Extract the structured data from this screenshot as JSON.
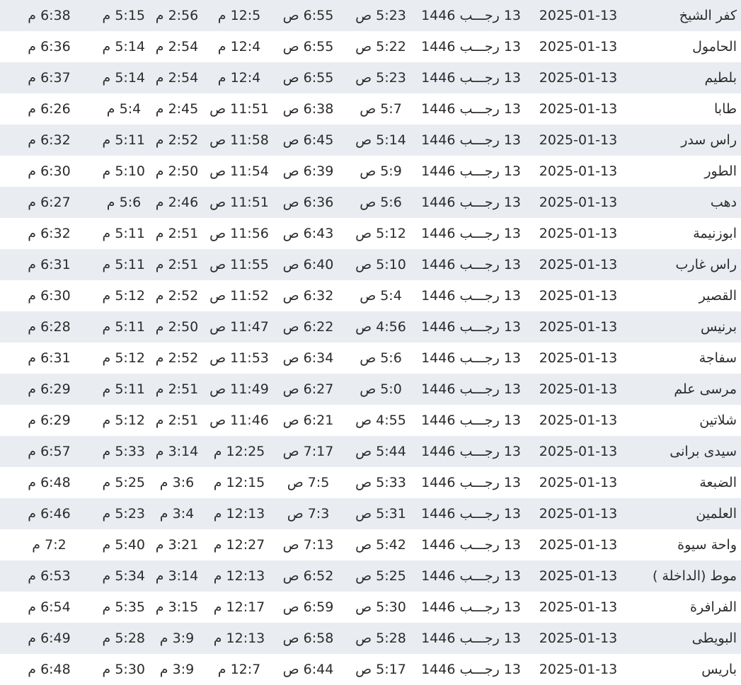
{
  "rows": [
    {
      "city": "كفر الشيخ",
      "gregorian": "2025-01-13",
      "hijri": "13 رجـــب 1446",
      "fajr": "5:23 ص",
      "sunrise": "6:55 ص",
      "dhuhr": "12:5 م",
      "asr": "2:56 م",
      "maghrib": "5:15 م",
      "isha": "6:38 م"
    },
    {
      "city": "الحامول",
      "gregorian": "2025-01-13",
      "hijri": "13 رجـــب 1446",
      "fajr": "5:22 ص",
      "sunrise": "6:55 ص",
      "dhuhr": "12:4 م",
      "asr": "2:54 م",
      "maghrib": "5:14 م",
      "isha": "6:36 م"
    },
    {
      "city": "بلطيم",
      "gregorian": "2025-01-13",
      "hijri": "13 رجـــب 1446",
      "fajr": "5:23 ص",
      "sunrise": "6:55 ص",
      "dhuhr": "12:4 م",
      "asr": "2:54 م",
      "maghrib": "5:14 م",
      "isha": "6:37 م"
    },
    {
      "city": "طابا",
      "gregorian": "2025-01-13",
      "hijri": "13 رجـــب 1446",
      "fajr": "5:7 ص",
      "sunrise": "6:38 ص",
      "dhuhr": "11:51 ص",
      "asr": "2:45 م",
      "maghrib": "5:4 م",
      "isha": "6:26 م"
    },
    {
      "city": "راس سدر",
      "gregorian": "2025-01-13",
      "hijri": "13 رجـــب 1446",
      "fajr": "5:14 ص",
      "sunrise": "6:45 ص",
      "dhuhr": "11:58 ص",
      "asr": "2:52 م",
      "maghrib": "5:11 م",
      "isha": "6:32 م"
    },
    {
      "city": "الطور",
      "gregorian": "2025-01-13",
      "hijri": "13 رجـــب 1446",
      "fajr": "5:9 ص",
      "sunrise": "6:39 ص",
      "dhuhr": "11:54 ص",
      "asr": "2:50 م",
      "maghrib": "5:10 م",
      "isha": "6:30 م"
    },
    {
      "city": "دهب",
      "gregorian": "2025-01-13",
      "hijri": "13 رجـــب 1446",
      "fajr": "5:6 ص",
      "sunrise": "6:36 ص",
      "dhuhr": "11:51 ص",
      "asr": "2:46 م",
      "maghrib": "5:6 م",
      "isha": "6:27 م"
    },
    {
      "city": "ابوزنيمة",
      "gregorian": "2025-01-13",
      "hijri": "13 رجـــب 1446",
      "fajr": "5:12 ص",
      "sunrise": "6:43 ص",
      "dhuhr": "11:56 ص",
      "asr": "2:51 م",
      "maghrib": "5:11 م",
      "isha": "6:32 م"
    },
    {
      "city": "راس غارب",
      "gregorian": "2025-01-13",
      "hijri": "13 رجـــب 1446",
      "fajr": "5:10 ص",
      "sunrise": "6:40 ص",
      "dhuhr": "11:55 ص",
      "asr": "2:51 م",
      "maghrib": "5:11 م",
      "isha": "6:31 م"
    },
    {
      "city": "القصير",
      "gregorian": "2025-01-13",
      "hijri": "13 رجـــب 1446",
      "fajr": "5:4 ص",
      "sunrise": "6:32 ص",
      "dhuhr": "11:52 ص",
      "asr": "2:52 م",
      "maghrib": "5:12 م",
      "isha": "6:30 م"
    },
    {
      "city": "برنيس",
      "gregorian": "2025-01-13",
      "hijri": "13 رجـــب 1446",
      "fajr": "4:56 ص",
      "sunrise": "6:22 ص",
      "dhuhr": "11:47 ص",
      "asr": "2:50 م",
      "maghrib": "5:11 م",
      "isha": "6:28 م"
    },
    {
      "city": "سفاجة",
      "gregorian": "2025-01-13",
      "hijri": "13 رجـــب 1446",
      "fajr": "5:6 ص",
      "sunrise": "6:34 ص",
      "dhuhr": "11:53 ص",
      "asr": "2:52 م",
      "maghrib": "5:12 م",
      "isha": "6:31 م"
    },
    {
      "city": "مرسى علم",
      "gregorian": "2025-01-13",
      "hijri": "13 رجـــب 1446",
      "fajr": "5:0 ص",
      "sunrise": "6:27 ص",
      "dhuhr": "11:49 ص",
      "asr": "2:51 م",
      "maghrib": "5:11 م",
      "isha": "6:29 م"
    },
    {
      "city": "شلاتين",
      "gregorian": "2025-01-13",
      "hijri": "13 رجـــب 1446",
      "fajr": "4:55 ص",
      "sunrise": "6:21 ص",
      "dhuhr": "11:46 ص",
      "asr": "2:51 م",
      "maghrib": "5:12 م",
      "isha": "6:29 م"
    },
    {
      "city": "سيدى برانى",
      "gregorian": "2025-01-13",
      "hijri": "13 رجـــب 1446",
      "fajr": "5:44 ص",
      "sunrise": "7:17 ص",
      "dhuhr": "12:25 م",
      "asr": "3:14 م",
      "maghrib": "5:33 م",
      "isha": "6:57 م"
    },
    {
      "city": "الضبعة",
      "gregorian": "2025-01-13",
      "hijri": "13 رجـــب 1446",
      "fajr": "5:33 ص",
      "sunrise": "7:5 ص",
      "dhuhr": "12:15 م",
      "asr": "3:6 م",
      "maghrib": "5:25 م",
      "isha": "6:48 م"
    },
    {
      "city": "العلمين",
      "gregorian": "2025-01-13",
      "hijri": "13 رجـــب 1446",
      "fajr": "5:31 ص",
      "sunrise": "7:3 ص",
      "dhuhr": "12:13 م",
      "asr": "3:4 م",
      "maghrib": "5:23 م",
      "isha": "6:46 م"
    },
    {
      "city": "واحة سيوة",
      "gregorian": "2025-01-13",
      "hijri": "13 رجـــب 1446",
      "fajr": "5:42 ص",
      "sunrise": "7:13 ص",
      "dhuhr": "12:27 م",
      "asr": "3:21 م",
      "maghrib": "5:40 م",
      "isha": "7:2 م"
    },
    {
      "city": "موط (الداخلة )",
      "gregorian": "2025-01-13",
      "hijri": "13 رجـــب 1446",
      "fajr": "5:25 ص",
      "sunrise": "6:52 ص",
      "dhuhr": "12:13 م",
      "asr": "3:14 م",
      "maghrib": "5:34 م",
      "isha": "6:53 م"
    },
    {
      "city": "الفرافرة",
      "gregorian": "2025-01-13",
      "hijri": "13 رجـــب 1446",
      "fajr": "5:30 ص",
      "sunrise": "6:59 ص",
      "dhuhr": "12:17 م",
      "asr": "3:15 م",
      "maghrib": "5:35 م",
      "isha": "6:54 م"
    },
    {
      "city": "البويطى",
      "gregorian": "2025-01-13",
      "hijri": "13 رجـــب 1446",
      "fajr": "5:28 ص",
      "sunrise": "6:58 ص",
      "dhuhr": "12:13 م",
      "asr": "3:9 م",
      "maghrib": "5:28 م",
      "isha": "6:49 م"
    },
    {
      "city": "باريس",
      "gregorian": "2025-01-13",
      "hijri": "13 رجـــب 1446",
      "fajr": "5:17 ص",
      "sunrise": "6:44 ص",
      "dhuhr": "12:7 م",
      "asr": "3:9 م",
      "maghrib": "5:30 م",
      "isha": "6:48 م"
    }
  ]
}
